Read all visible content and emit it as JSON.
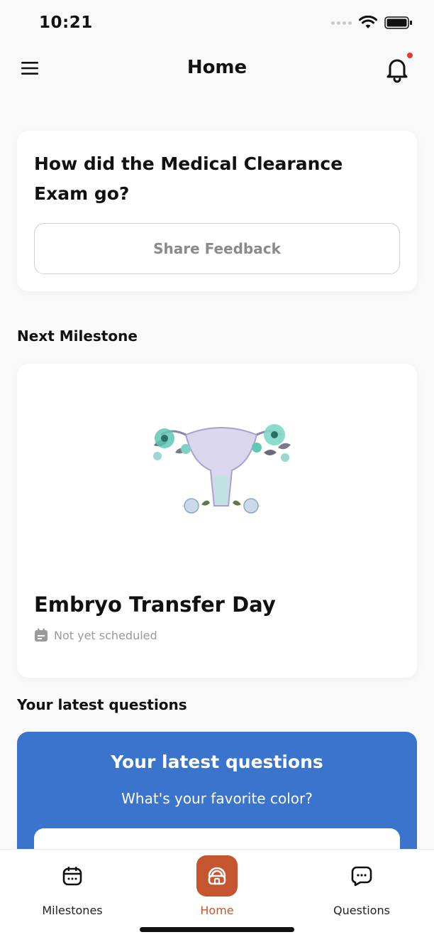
{
  "status_bar": {
    "time": "10:21"
  },
  "header": {
    "title": "Home"
  },
  "feedback_card": {
    "question": "How did the Medical Clearance Exam go?",
    "button_label": "Share Feedback"
  },
  "next_milestone": {
    "section_title": "Next Milestone",
    "name": "Embryo Transfer Day",
    "schedule_status": "Not yet scheduled"
  },
  "latest_questions": {
    "section_title": "Your latest questions",
    "card_title": "Your latest questions",
    "question": "What's your favorite color?"
  },
  "tab_bar": {
    "tabs": [
      {
        "label": "Milestones",
        "icon": "calendar-icon"
      },
      {
        "label": "Home",
        "icon": "home-icon"
      },
      {
        "label": "Questions",
        "icon": "chat-icon"
      }
    ],
    "active_index": 1
  },
  "colors": {
    "accent": "#c4552f",
    "questions_card": "#3a74cc",
    "notification_dot": "#e53935"
  }
}
